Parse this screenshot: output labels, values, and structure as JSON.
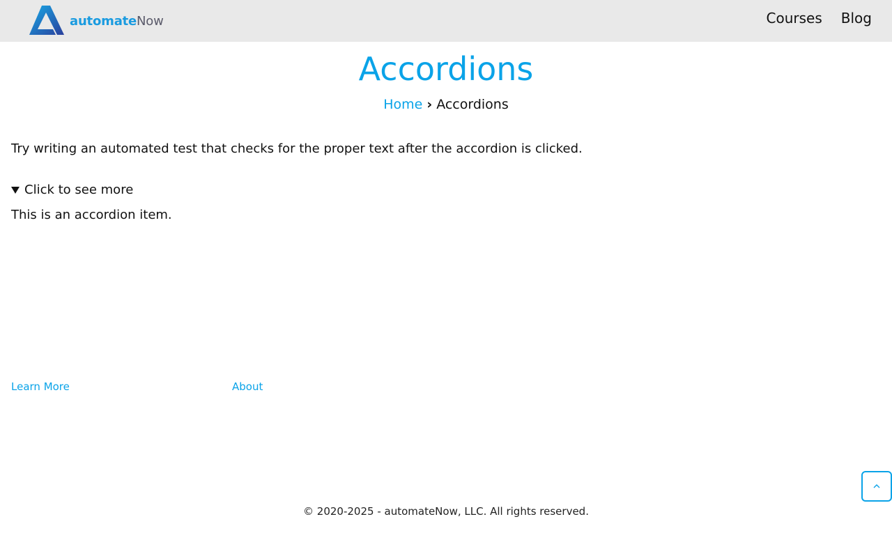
{
  "header": {
    "logo_text_bold": "automate",
    "logo_text_light": "Now",
    "nav": [
      {
        "label": "Courses"
      },
      {
        "label": "Blog"
      }
    ]
  },
  "page": {
    "title": "Accordions",
    "breadcrumb": {
      "home": "Home",
      "separator": "›",
      "current": "Accordions"
    },
    "intro": "Try writing an automated test that checks for the proper text after the accordion is clicked.",
    "accordion": {
      "summary": "Click to see more",
      "content": "This is an accordion item.",
      "expanded": true
    }
  },
  "footer": {
    "links": [
      {
        "label": "Learn More"
      },
      {
        "label": "About"
      }
    ],
    "copyright": "© 2020-2025 - automateNow, LLC. All rights reserved."
  },
  "colors": {
    "accent": "#0aa3e8",
    "header_bg": "#e9e9e9"
  },
  "icons": {
    "scroll_top": "chevron-up-icon",
    "accordion_state": "triangle-down-icon"
  }
}
